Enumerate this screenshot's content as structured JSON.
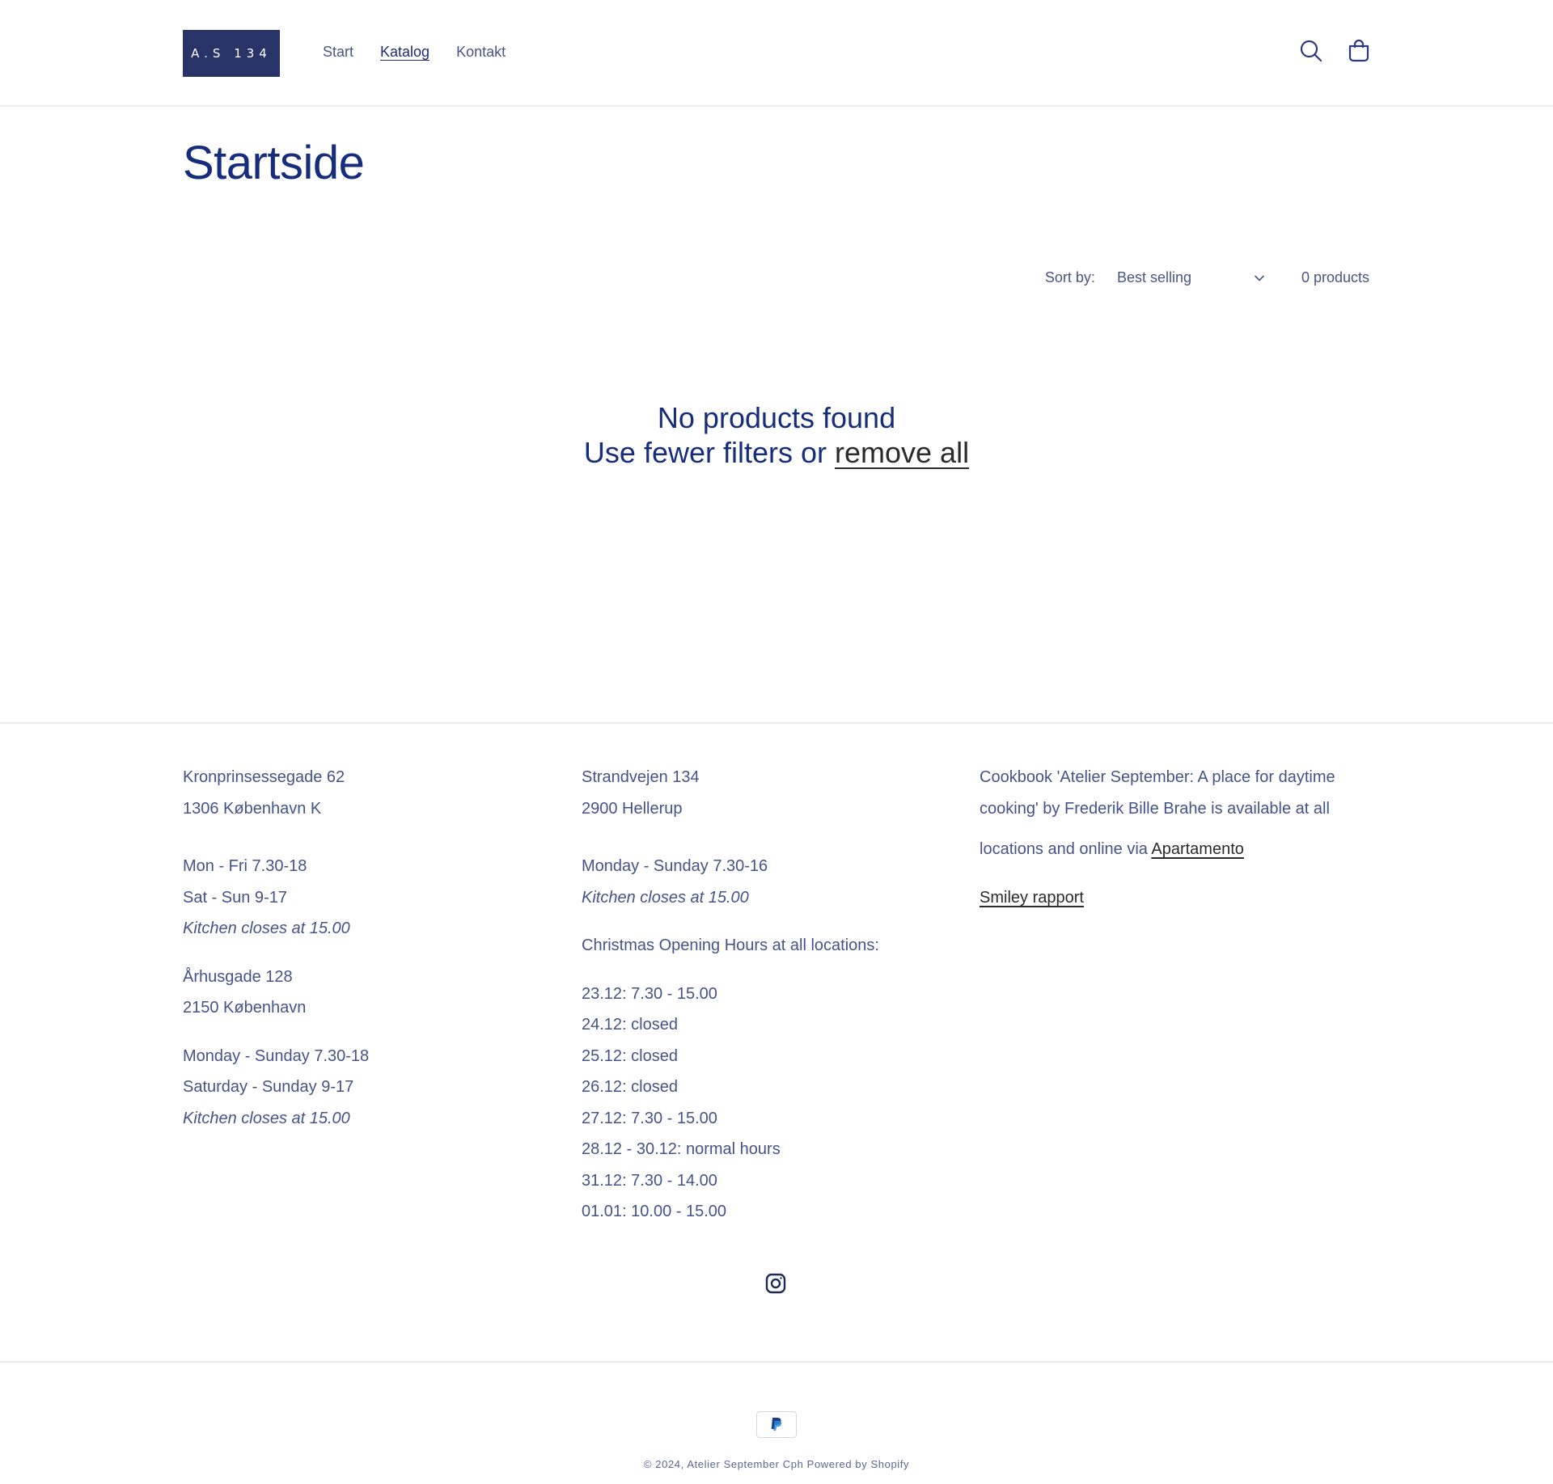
{
  "brand": {
    "logo_text": "A.S 134"
  },
  "nav": {
    "items": [
      {
        "label": "Start"
      },
      {
        "label": "Katalog"
      },
      {
        "label": "Kontakt"
      }
    ]
  },
  "header_icons": [
    "search-icon",
    "cart-icon"
  ],
  "page": {
    "title": "Startside"
  },
  "sort": {
    "label": "Sort by:",
    "selected": "Best selling",
    "count": "0 products"
  },
  "empty_state": {
    "line1": "No products found",
    "line2_prefix": "Use fewer filters or",
    "remove_all": "remove all"
  },
  "footer": {
    "col1": {
      "address1_line1": "Kronprinsessegade 62",
      "address1_line2": "1306 København K",
      "hours1_line1": "Mon - Fri 7.30-18",
      "hours1_line2": "Sat - Sun 9-17",
      "kitchen1": "Kitchen closes at 15.00",
      "address2_line1": "Århusgade 128",
      "address2_line2": "2150 København",
      "hours2_line1": "Monday - Sunday 7.30-18",
      "hours2_line2": "Saturday - Sunday 9-17",
      "kitchen2": "Kitchen closes at 15.00"
    },
    "col2": {
      "address_line1": "Strandvejen 134",
      "address_line2": "2900 Hellerup",
      "hours": "Monday - Sunday 7.30-16",
      "kitchen": "Kitchen closes at 15.00",
      "christmas_heading": "Christmas Opening Hours at all locations:",
      "christmas_hours": [
        "23.12: 7.30 - 15.00",
        "24.12: closed",
        "25.12: closed",
        "26.12: closed",
        "27.12: 7.30 - 15.00",
        "28.12 - 30.12: normal hours",
        "31.12: 7.30 - 14.00",
        "01.01: 10.00 - 15.00"
      ]
    },
    "col3": {
      "cookbook_line1": "Cookbook 'Atelier September: A place for daytime",
      "cookbook_line2": "cooking' by Frederik Bille Brahe is available at all",
      "cookbook_line3_prefix": "locations and online via",
      "apartamento_link": "Apartamento",
      "smiley_link": "Smiley rapport"
    },
    "social_icon": "instagram-icon",
    "payment_icon": "paypal-icon",
    "copyright_prefix": "© 2024,",
    "copyright_store": "Atelier September Cph",
    "copyright_powered": "Powered by Shopify"
  },
  "colors": {
    "brand_navy": "#283368",
    "heading_blue": "#152d7a",
    "text_blue": "#45538a"
  }
}
